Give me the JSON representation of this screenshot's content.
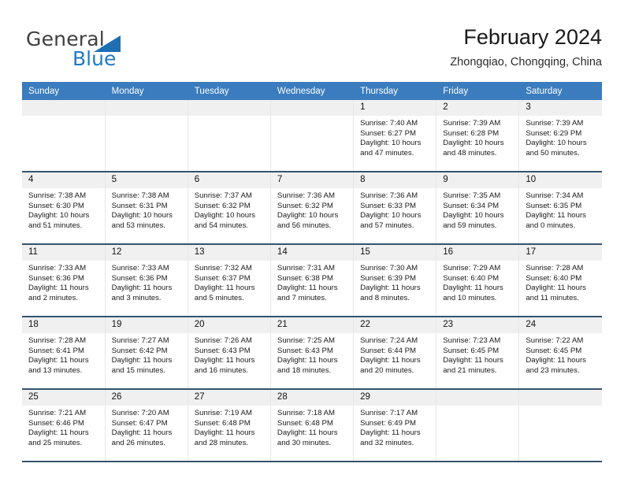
{
  "brand": {
    "name_part1": "General",
    "name_part2": "Blue",
    "accent_color": "#1f7ac4",
    "triangle_icon": "triangle-icon"
  },
  "header": {
    "title": "February 2024",
    "location": "Zhongqiao, Chongqing, China"
  },
  "calendar": {
    "header_bg": "#3a7cbd",
    "daynum_bg": "#f0f0f0",
    "row_separator_color": "#35536e",
    "weekday_headers": [
      "Sunday",
      "Monday",
      "Tuesday",
      "Wednesday",
      "Thursday",
      "Friday",
      "Saturday"
    ],
    "weeks": [
      [
        {
          "day": "",
          "empty": true
        },
        {
          "day": "",
          "empty": true
        },
        {
          "day": "",
          "empty": true
        },
        {
          "day": "",
          "empty": true
        },
        {
          "day": "1",
          "sunrise": "Sunrise: 7:40 AM",
          "sunset": "Sunset: 6:27 PM",
          "daylight_line1": "Daylight: 10 hours",
          "daylight_line2": "and 47 minutes."
        },
        {
          "day": "2",
          "sunrise": "Sunrise: 7:39 AM",
          "sunset": "Sunset: 6:28 PM",
          "daylight_line1": "Daylight: 10 hours",
          "daylight_line2": "and 48 minutes."
        },
        {
          "day": "3",
          "sunrise": "Sunrise: 7:39 AM",
          "sunset": "Sunset: 6:29 PM",
          "daylight_line1": "Daylight: 10 hours",
          "daylight_line2": "and 50 minutes."
        }
      ],
      [
        {
          "day": "4",
          "sunrise": "Sunrise: 7:38 AM",
          "sunset": "Sunset: 6:30 PM",
          "daylight_line1": "Daylight: 10 hours",
          "daylight_line2": "and 51 minutes."
        },
        {
          "day": "5",
          "sunrise": "Sunrise: 7:38 AM",
          "sunset": "Sunset: 6:31 PM",
          "daylight_line1": "Daylight: 10 hours",
          "daylight_line2": "and 53 minutes."
        },
        {
          "day": "6",
          "sunrise": "Sunrise: 7:37 AM",
          "sunset": "Sunset: 6:32 PM",
          "daylight_line1": "Daylight: 10 hours",
          "daylight_line2": "and 54 minutes."
        },
        {
          "day": "7",
          "sunrise": "Sunrise: 7:36 AM",
          "sunset": "Sunset: 6:32 PM",
          "daylight_line1": "Daylight: 10 hours",
          "daylight_line2": "and 56 minutes."
        },
        {
          "day": "8",
          "sunrise": "Sunrise: 7:36 AM",
          "sunset": "Sunset: 6:33 PM",
          "daylight_line1": "Daylight: 10 hours",
          "daylight_line2": "and 57 minutes."
        },
        {
          "day": "9",
          "sunrise": "Sunrise: 7:35 AM",
          "sunset": "Sunset: 6:34 PM",
          "daylight_line1": "Daylight: 10 hours",
          "daylight_line2": "and 59 minutes."
        },
        {
          "day": "10",
          "sunrise": "Sunrise: 7:34 AM",
          "sunset": "Sunset: 6:35 PM",
          "daylight_line1": "Daylight: 11 hours",
          "daylight_line2": "and 0 minutes."
        }
      ],
      [
        {
          "day": "11",
          "sunrise": "Sunrise: 7:33 AM",
          "sunset": "Sunset: 6:36 PM",
          "daylight_line1": "Daylight: 11 hours",
          "daylight_line2": "and 2 minutes."
        },
        {
          "day": "12",
          "sunrise": "Sunrise: 7:33 AM",
          "sunset": "Sunset: 6:36 PM",
          "daylight_line1": "Daylight: 11 hours",
          "daylight_line2": "and 3 minutes."
        },
        {
          "day": "13",
          "sunrise": "Sunrise: 7:32 AM",
          "sunset": "Sunset: 6:37 PM",
          "daylight_line1": "Daylight: 11 hours",
          "daylight_line2": "and 5 minutes."
        },
        {
          "day": "14",
          "sunrise": "Sunrise: 7:31 AM",
          "sunset": "Sunset: 6:38 PM",
          "daylight_line1": "Daylight: 11 hours",
          "daylight_line2": "and 7 minutes."
        },
        {
          "day": "15",
          "sunrise": "Sunrise: 7:30 AM",
          "sunset": "Sunset: 6:39 PM",
          "daylight_line1": "Daylight: 11 hours",
          "daylight_line2": "and 8 minutes."
        },
        {
          "day": "16",
          "sunrise": "Sunrise: 7:29 AM",
          "sunset": "Sunset: 6:40 PM",
          "daylight_line1": "Daylight: 11 hours",
          "daylight_line2": "and 10 minutes."
        },
        {
          "day": "17",
          "sunrise": "Sunrise: 7:28 AM",
          "sunset": "Sunset: 6:40 PM",
          "daylight_line1": "Daylight: 11 hours",
          "daylight_line2": "and 11 minutes."
        }
      ],
      [
        {
          "day": "18",
          "sunrise": "Sunrise: 7:28 AM",
          "sunset": "Sunset: 6:41 PM",
          "daylight_line1": "Daylight: 11 hours",
          "daylight_line2": "and 13 minutes."
        },
        {
          "day": "19",
          "sunrise": "Sunrise: 7:27 AM",
          "sunset": "Sunset: 6:42 PM",
          "daylight_line1": "Daylight: 11 hours",
          "daylight_line2": "and 15 minutes."
        },
        {
          "day": "20",
          "sunrise": "Sunrise: 7:26 AM",
          "sunset": "Sunset: 6:43 PM",
          "daylight_line1": "Daylight: 11 hours",
          "daylight_line2": "and 16 minutes."
        },
        {
          "day": "21",
          "sunrise": "Sunrise: 7:25 AM",
          "sunset": "Sunset: 6:43 PM",
          "daylight_line1": "Daylight: 11 hours",
          "daylight_line2": "and 18 minutes."
        },
        {
          "day": "22",
          "sunrise": "Sunrise: 7:24 AM",
          "sunset": "Sunset: 6:44 PM",
          "daylight_line1": "Daylight: 11 hours",
          "daylight_line2": "and 20 minutes."
        },
        {
          "day": "23",
          "sunrise": "Sunrise: 7:23 AM",
          "sunset": "Sunset: 6:45 PM",
          "daylight_line1": "Daylight: 11 hours",
          "daylight_line2": "and 21 minutes."
        },
        {
          "day": "24",
          "sunrise": "Sunrise: 7:22 AM",
          "sunset": "Sunset: 6:45 PM",
          "daylight_line1": "Daylight: 11 hours",
          "daylight_line2": "and 23 minutes."
        }
      ],
      [
        {
          "day": "25",
          "sunrise": "Sunrise: 7:21 AM",
          "sunset": "Sunset: 6:46 PM",
          "daylight_line1": "Daylight: 11 hours",
          "daylight_line2": "and 25 minutes."
        },
        {
          "day": "26",
          "sunrise": "Sunrise: 7:20 AM",
          "sunset": "Sunset: 6:47 PM",
          "daylight_line1": "Daylight: 11 hours",
          "daylight_line2": "and 26 minutes."
        },
        {
          "day": "27",
          "sunrise": "Sunrise: 7:19 AM",
          "sunset": "Sunset: 6:48 PM",
          "daylight_line1": "Daylight: 11 hours",
          "daylight_line2": "and 28 minutes."
        },
        {
          "day": "28",
          "sunrise": "Sunrise: 7:18 AM",
          "sunset": "Sunset: 6:48 PM",
          "daylight_line1": "Daylight: 11 hours",
          "daylight_line2": "and 30 minutes."
        },
        {
          "day": "29",
          "sunrise": "Sunrise: 7:17 AM",
          "sunset": "Sunset: 6:49 PM",
          "daylight_line1": "Daylight: 11 hours",
          "daylight_line2": "and 32 minutes."
        },
        {
          "day": "",
          "empty": true
        },
        {
          "day": "",
          "empty": true
        }
      ]
    ]
  }
}
